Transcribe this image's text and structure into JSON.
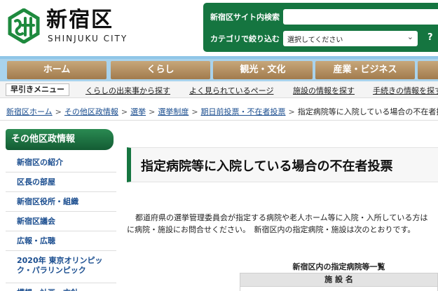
{
  "header": {
    "site_name": "新宿区",
    "site_name_en": "SHINJUKU CITY",
    "colors": {
      "brand_green": "#157540",
      "nav_brown": "#a27b4d",
      "nav_blue": "#a9d3ec",
      "link_blue": "#1a4d8f"
    }
  },
  "search": {
    "label": "新宿区サイト内検索",
    "category_label": "カテゴリで絞り込む",
    "category_value": "選択してください",
    "help": "?"
  },
  "nav": {
    "items": [
      {
        "label": "ホーム"
      },
      {
        "label": "くらし"
      },
      {
        "label": "観光・文化"
      },
      {
        "label": "産業・ビジネス"
      }
    ]
  },
  "quick_menu": {
    "title": "早引きメニュー",
    "links": [
      {
        "label": "くらしの出来事から探す"
      },
      {
        "label": "よく見られているページ"
      },
      {
        "label": "施設の情報を探す"
      },
      {
        "label": "手続きの情報を探す"
      }
    ]
  },
  "breadcrumb": {
    "items": [
      {
        "label": "新宿区ホーム"
      },
      {
        "label": "その他区政情報"
      },
      {
        "label": "選挙"
      },
      {
        "label": "選挙制度"
      },
      {
        "label": "期日前投票・不在者投票"
      }
    ],
    "separator": ">",
    "current": "指定病院等に入院している場合の不在者投票"
  },
  "sidebar": {
    "title": "その他区政情報",
    "items": [
      {
        "label": "新宿区の紹介"
      },
      {
        "label": "区長の部屋"
      },
      {
        "label": "新宿区役所・組織"
      },
      {
        "label": "新宿区議会"
      },
      {
        "label": "広報・広聴"
      },
      {
        "label": "2020年 東京オリンピック・パラリンピック"
      },
      {
        "label": "構想・計画・方針"
      }
    ]
  },
  "main": {
    "title": "指定病院等に入院している場合の不在者投票",
    "paragraph_line1": "都道府県の選挙管理委員会が指定する病院や老人ホーム等に入院・入所している方は",
    "paragraph_line2": "に病院・施設にお問合せください。　新宿区内の指定病院・施設は次のとおりです。",
    "table_caption": "新宿区内の指定病院等一覧",
    "table_header": "施 設 名"
  }
}
